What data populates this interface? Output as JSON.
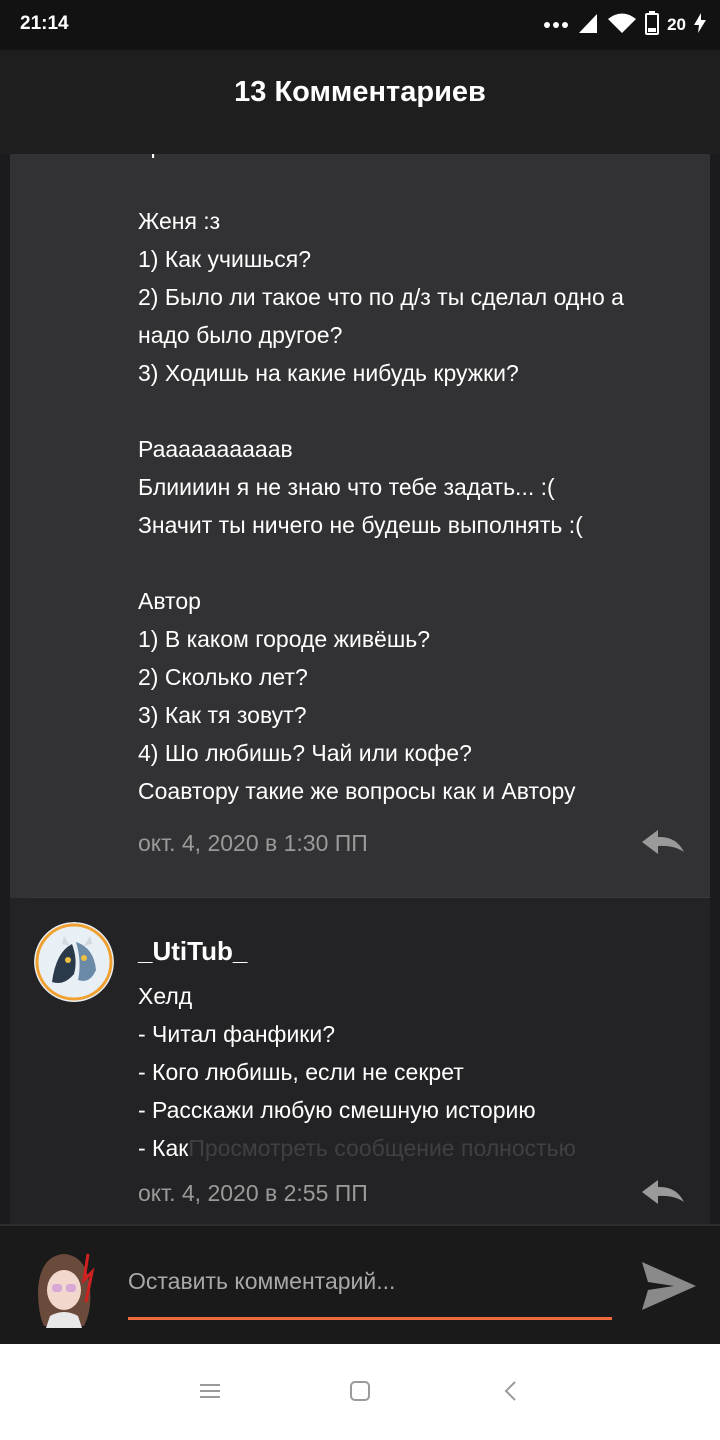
{
  "status_bar": {
    "time": "21:14",
    "battery": "20"
  },
  "header": {
    "title": "13 Комментариев"
  },
  "comments": [
    {
      "lines": [
        "произошла с тобой за всю жизнь?",
        "",
        "Женя :з",
        "1) Как учишься?",
        "2) Было ли такое что по д/з ты сделал одно а",
        "надо было другое?",
        "3) Ходишь на какие нибудь кружки?",
        "",
        "Раааааааааав",
        "Блиииин я не знаю что тебе задать... :(",
        "Значит ты ничего не будешь выполнять :(",
        "",
        "Автор",
        "1) В каком городе живёшь?",
        "2) Сколько лет?",
        "3) Как тя зовут?",
        "4) Шо любишь? Чай или кофе?",
        "Соавтору такие же вопросы как и Автору"
      ],
      "timestamp": "окт. 4, 2020 в 1:30 ПП",
      "reply_icon": "reply-icon"
    },
    {
      "author": "_UtiTub_",
      "lines": [
        "Хелд",
        "- Читал фанфики?",
        "- Кого любишь,  если не секрет",
        "- Расскажи любую смешную историю"
      ],
      "truncated_start": "- Как",
      "view_full": "Просмотреть сообщение полностью",
      "timestamp": "окт. 4, 2020 в 2:55 ПП",
      "reply_icon": "reply-icon"
    }
  ],
  "composer": {
    "placeholder": "Оставить комментарий...",
    "accent_color": "#ef6a3c"
  },
  "nav": {
    "icons": [
      "menu-icon",
      "home-square-icon",
      "back-icon"
    ]
  }
}
